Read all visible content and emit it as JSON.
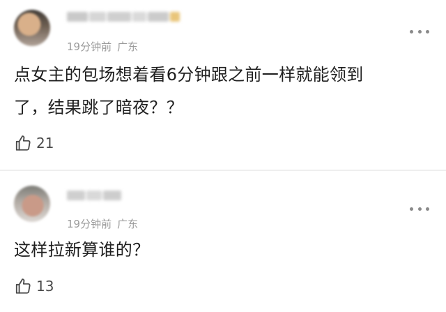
{
  "comments": [
    {
      "meta": {
        "time": "19分钟前",
        "location": "广东"
      },
      "content_line1": "点女主的包场想着看6分钟跟之前一样就能领到",
      "content_line2": "了，结果跳了暗夜？？",
      "likes": "21"
    },
    {
      "meta": {
        "time": "19分钟前",
        "location": "广东"
      },
      "content_line1": "这样拉新算谁的？",
      "likes": "13"
    }
  ],
  "icons": {
    "more": "more-dots-icon",
    "like": "thumbs-up-icon"
  }
}
